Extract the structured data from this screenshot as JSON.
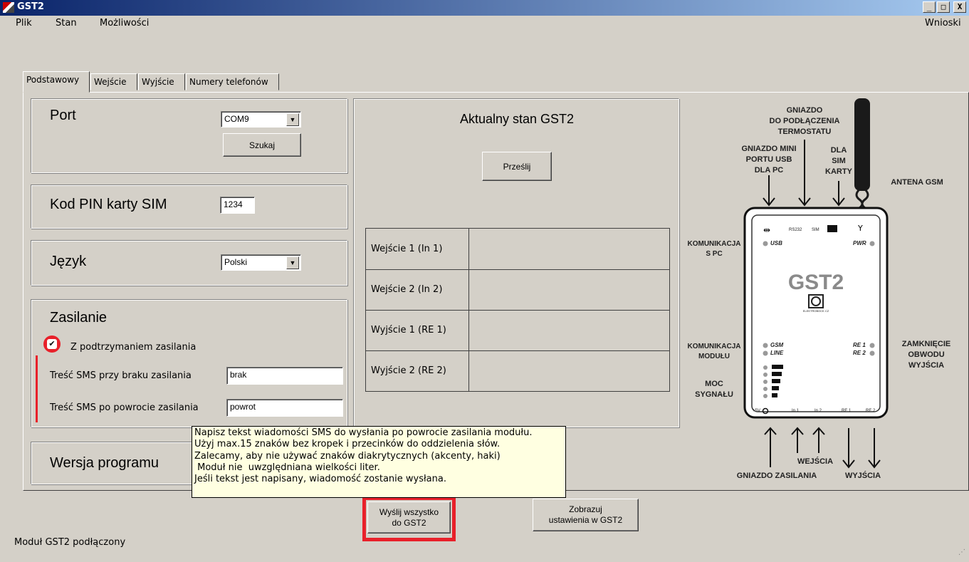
{
  "window": {
    "title": "GST2",
    "min_label": "_",
    "max_label": "□",
    "close_label": "X"
  },
  "menu": {
    "items": [
      "Plik",
      "Stan",
      "Możliwości"
    ],
    "right": "Wnioski"
  },
  "tabs": [
    "Podstawowy",
    "Wejście",
    "Wyjście",
    "Numery telefonów"
  ],
  "port": {
    "label": "Port",
    "value": "COM9",
    "search_button": "Szukaj"
  },
  "pin": {
    "label": "Kod PIN karty SIM",
    "value": "1234"
  },
  "language": {
    "label": "Język",
    "value": "Polski"
  },
  "power": {
    "label": "Zasilanie",
    "checkbox_label": "Z podtrzymaniem zasilania",
    "checked": true,
    "sms_no_power_label": "Treść SMS przy  braku zasilania",
    "sms_no_power_value": "brak",
    "sms_power_back_label": "Treść SMS po powrocie zasilania",
    "sms_power_back_value": "powrot"
  },
  "version": {
    "label": "Wersja programu"
  },
  "state": {
    "title": "Aktualny stan GST2",
    "send_button": "Prześlij",
    "rows": [
      {
        "name": "Wejście 1 (In 1)",
        "value": ""
      },
      {
        "name": "Wejście 2 (In 2)",
        "value": ""
      },
      {
        "name": "Wyjście 1 (RE 1)",
        "value": ""
      },
      {
        "name": "Wyjście 2 (RE 2)",
        "value": ""
      }
    ]
  },
  "tooltip": {
    "lines": [
      "Napisz tekst wiadomości SMS do wysłania po powrocie zasilania modułu.",
      "Użyj max.15 znaków bez kropek i przecinków do oddzielenia słów.",
      "Zalecamy, aby nie używać znaków diakrytycznych (akcenty, haki)",
      " Moduł nie  uwzględniana wielkości liter.",
      "Jeśli tekst jest napisany, wiadomość zostanie wysłana."
    ]
  },
  "buttons": {
    "send_all": [
      "Wyślij wszystko",
      "do GST2"
    ],
    "show_settings": [
      "Zobrazuj",
      "ustawienia w GST2"
    ]
  },
  "status": "Moduł GST2 podłączony",
  "device": {
    "name": "GST2",
    "labels": {
      "thermostat": [
        "GNIAZDO",
        "DO PODŁĄCZENIA",
        "TERMOSTATU"
      ],
      "usb": [
        "GNIAZDO MINI",
        "PORTU USB",
        "DLA PC"
      ],
      "sim": [
        "DLA",
        "SIM",
        "KARTY"
      ],
      "antenna": "ANTENA GSM",
      "pc_comm": [
        "KOMUNIKACJA",
        "S PC"
      ],
      "module_comm": [
        "KOMUNIKACJA",
        "MODUŁU"
      ],
      "signal": [
        "MOC",
        "SYGNAŁU"
      ],
      "output_close": [
        "ZAMKNIĘCIE",
        "OBWODU",
        "WYJŚCIA"
      ],
      "inputs": "WEJŚCIA",
      "power_socket": "GNIAZDO ZASILANIA",
      "outputs": "WYJŚCIA"
    },
    "panel": {
      "rs232": "RS232",
      "sim": "SIM",
      "usb": "USB",
      "pwr": "PWR",
      "gsm": "GSM",
      "line": "LINE",
      "re1": "RE 1",
      "re2": "RE 2",
      "bottom": [
        "+5V",
        "In 1",
        "In 2",
        "RE 1",
        "RE 2"
      ],
      "logo_sub": "ELEKTROBOCK CZ"
    }
  },
  "colors": {
    "highlight": "#e8202a",
    "tooltip_bg": "#ffffe1",
    "titlebar": "#0a246a"
  }
}
